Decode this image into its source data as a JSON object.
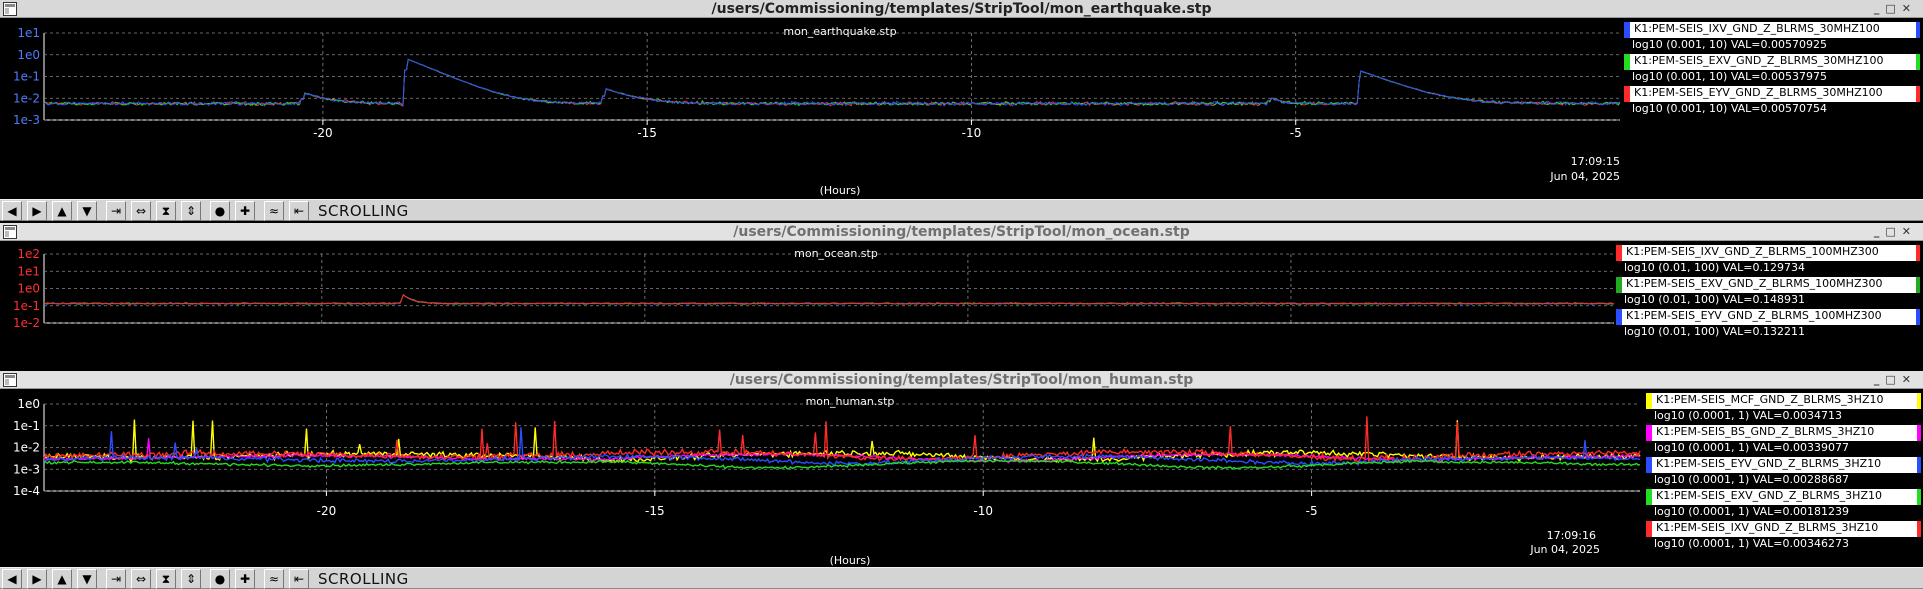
{
  "colors": {
    "red": "#ff2a2a",
    "green": "#22dd22",
    "blue": "#2a4dff",
    "yellow": "#ffff00",
    "magenta": "#ff00ff"
  },
  "toolbar": {
    "mode": "SCROLLING",
    "buttons": [
      "arrow-left-icon",
      "arrow-right-icon",
      "arrow-up-icon",
      "arrow-down-icon",
      "zoom-in-horizontal-icon",
      "zoom-out-horizontal-icon",
      "zoom-in-vertical-icon",
      "zoom-out-vertical-icon",
      "reset-icon",
      "add-icon",
      "graph-options-icon",
      "exit-icon"
    ]
  },
  "windows": [
    {
      "title": "/users/Commissioning/templates/StripTool/mon_earthquake.stp",
      "plot_title": "mon_earthquake.stp",
      "timestamp_time": "17:09:15",
      "timestamp_date": "Jun 04, 2025",
      "xlabel": "(Hours)",
      "legend": [
        {
          "name": "K1:PEM-SEIS_IXV_GND_Z_BLRMS_30MHZ100",
          "range": "log10 (0.001, 10) VAL=0.00570925",
          "color": "#2a4dff"
        },
        {
          "name": "K1:PEM-SEIS_EXV_GND_Z_BLRMS_30MHZ100",
          "range": "log10 (0.001, 10) VAL=0.00537975",
          "color": "#22dd22"
        },
        {
          "name": "K1:PEM-SEIS_EYV_GND_Z_BLRMS_30MHZ100",
          "range": "log10 (0.001, 10) VAL=0.00570754",
          "color": "#ff2a2a"
        }
      ]
    },
    {
      "title": "/users/Commissioning/templates/StripTool/mon_ocean.stp",
      "plot_title": "mon_ocean.stp",
      "legend": [
        {
          "name": "K1:PEM-SEIS_IXV_GND_Z_BLRMS_100MHZ300",
          "range": "log10 (0.01, 100) VAL=0.129734",
          "color": "#ff2a2a"
        },
        {
          "name": "K1:PEM-SEIS_EXV_GND_Z_BLRMS_100MHZ300",
          "range": "log10 (0.01, 100) VAL=0.148931",
          "color": "#22aa22"
        },
        {
          "name": "K1:PEM-SEIS_EYV_GND_Z_BLRMS_100MHZ300",
          "range": "log10 (0.01, 100) VAL=0.132211",
          "color": "#2a4dff"
        }
      ]
    },
    {
      "title": "/users/Commissioning/templates/StripTool/mon_human.stp",
      "plot_title": "mon_human.stp",
      "timestamp_time": "17:09:16",
      "timestamp_date": "Jun 04, 2025",
      "xlabel": "(Hours)",
      "legend": [
        {
          "name": "K1:PEM-SEIS_MCF_GND_Z_BLRMS_3HZ10",
          "range": "log10 (0.0001, 1) VAL=0.0034713",
          "color": "#ffff00"
        },
        {
          "name": "K1:PEM-SEIS_BS_GND_Z_BLRMS_3HZ10",
          "range": "log10 (0.0001, 1) VAL=0.00339077",
          "color": "#ff00ff"
        },
        {
          "name": "K1:PEM-SEIS_EYV_GND_Z_BLRMS_3HZ10",
          "range": "log10 (0.0001, 1) VAL=0.00288687",
          "color": "#2a4dff"
        },
        {
          "name": "K1:PEM-SEIS_EXV_GND_Z_BLRMS_3HZ10",
          "range": "log10 (0.0001, 1) VAL=0.00181239",
          "color": "#22dd22"
        },
        {
          "name": "K1:PEM-SEIS_IXV_GND_Z_BLRMS_3HZ10",
          "range": "log10 (0.0001, 1) VAL=0.00346273",
          "color": "#ff2a2a"
        }
      ]
    }
  ],
  "chart_data": [
    {
      "type": "line",
      "title": "mon_earthquake.stp",
      "xlabel": "(Hours)",
      "x_ticks": [
        -20,
        -15,
        -10,
        -5
      ],
      "xlim": [
        -24.3,
        0
      ],
      "y_scale": "log",
      "y_ticks": [
        "1e1",
        "1e0",
        "1e-1",
        "1e-2",
        "1e-3"
      ],
      "ylim": [
        0.001,
        10
      ],
      "grid": true,
      "baseline": 0.0057,
      "noise_decades": 0.12,
      "events": [
        {
          "x": -20.3,
          "peak": 0.018,
          "tau": 0.3
        },
        {
          "x": -18.7,
          "peak": 0.65,
          "tau": 0.35
        },
        {
          "x": -15.65,
          "peak": 0.028,
          "tau": 0.35
        },
        {
          "x": -4.0,
          "peak": 0.18,
          "tau": 0.4
        },
        {
          "x": -5.4,
          "peak": 0.011,
          "tau": 0.15
        }
      ],
      "series": [
        {
          "name": "K1:PEM-SEIS_IXV_GND_Z_BLRMS_30MHZ100",
          "color": "#2a4dff",
          "last": 0.00570925
        },
        {
          "name": "K1:PEM-SEIS_EXV_GND_Z_BLRMS_30MHZ100",
          "color": "#22dd22",
          "last": 0.00537975
        },
        {
          "name": "K1:PEM-SEIS_EYV_GND_Z_BLRMS_30MHZ100",
          "color": "#ff2a2a",
          "last": 0.00570754
        }
      ]
    },
    {
      "type": "line",
      "title": "mon_ocean.stp",
      "xlim": [
        -24.3,
        0
      ],
      "y_scale": "log",
      "y_ticks": [
        "1e2",
        "1e1",
        "1e0",
        "1e-1",
        "1e-2"
      ],
      "ylim": [
        0.01,
        100
      ],
      "grid": true,
      "baseline": 0.135,
      "noise_decades": 0.07,
      "events": [
        {
          "x": -18.75,
          "peak": 0.45,
          "tau": 0.12
        }
      ],
      "series": [
        {
          "name": "K1:PEM-SEIS_IXV_GND_Z_BLRMS_100MHZ300",
          "color": "#ff2a2a",
          "last": 0.129734
        },
        {
          "name": "K1:PEM-SEIS_EXV_GND_Z_BLRMS_100MHZ300",
          "color": "#22aa22",
          "last": 0.148931
        },
        {
          "name": "K1:PEM-SEIS_EYV_GND_Z_BLRMS_100MHZ300",
          "color": "#2a4dff",
          "last": 0.132211
        }
      ]
    },
    {
      "type": "line",
      "title": "mon_human.stp",
      "xlabel": "(Hours)",
      "x_ticks": [
        -20,
        -15,
        -10,
        -5
      ],
      "xlim": [
        -24.3,
        0
      ],
      "y_scale": "log",
      "y_ticks": [
        "1e0",
        "1e-1",
        "1e-2",
        "1e-3",
        "1e-4"
      ],
      "ylim": [
        0.0001,
        1
      ],
      "grid": true,
      "series": [
        {
          "name": "K1:PEM-SEIS_EXV_GND_Z_BLRMS_3HZ10",
          "color": "#22dd22",
          "level": 0.0018,
          "noise": 0.09,
          "spike_rate": 0.002,
          "last": 0.00181239
        },
        {
          "name": "K1:PEM-SEIS_EYV_GND_Z_BLRMS_3HZ10",
          "color": "#2a4dff",
          "level": 0.0029,
          "noise": 0.15,
          "spike_rate": 0.004,
          "last": 0.00288687
        },
        {
          "name": "K1:PEM-SEIS_IXV_GND_Z_BLRMS_3HZ10",
          "color": "#ff2a2a",
          "level": 0.0046,
          "noise": 0.2,
          "spike_rate": 0.01,
          "last": 0.00346273
        },
        {
          "name": "K1:PEM-SEIS_BS_GND_Z_BLRMS_3HZ10",
          "color": "#ff00ff",
          "level": 0.0036,
          "noise": 0.1,
          "spike_rate": 0.002,
          "last": 0.00339077
        },
        {
          "name": "K1:PEM-SEIS_MCF_GND_Z_BLRMS_3HZ10",
          "color": "#ffff00",
          "level": 0.0042,
          "noise": 0.2,
          "spike_rate": 0.012,
          "last": 0.0034713
        }
      ]
    }
  ]
}
